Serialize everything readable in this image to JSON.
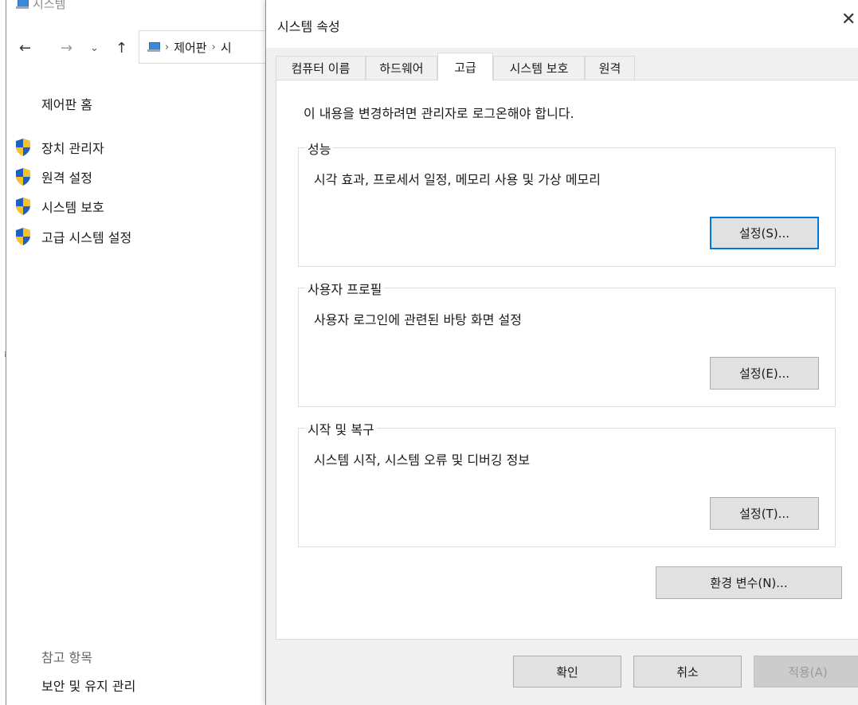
{
  "background": {
    "title": "시스템",
    "nav": {
      "back": "←",
      "forward": "→",
      "recent": "⌄",
      "up": "↑"
    },
    "breadcrumb": [
      "제어판",
      "시"
    ],
    "sidebar": {
      "home": "제어판 홈",
      "links": [
        "장치 관리자",
        "원격 설정",
        "시스템 보호",
        "고급 시스템 설정"
      ]
    },
    "see_also": {
      "heading": "참고 항목",
      "link": "보안 및 유지 관리"
    }
  },
  "dialog": {
    "title": "시스템 속성",
    "close": "✕",
    "tabs": [
      "컴퓨터 이름",
      "하드웨어",
      "고급",
      "시스템 보호",
      "원격"
    ],
    "active_tab": "고급",
    "admin_note": "이 내용을 변경하려면 관리자로 로그온해야 합니다.",
    "groups": {
      "performance": {
        "legend": "성능",
        "desc": "시각 효과, 프로세서 일정, 메모리 사용 및 가상 메모리",
        "button": "설정(S)..."
      },
      "profile": {
        "legend": "사용자 프로필",
        "desc": "사용자 로그인에 관련된 바탕 화면 설정",
        "button": "설정(E)..."
      },
      "startup": {
        "legend": "시작 및 복구",
        "desc": "시스템 시작, 시스템 오류 및 디버깅 정보",
        "button": "설정(T)..."
      }
    },
    "env_button": "환경 변수(N)...",
    "ok": "확인",
    "cancel": "취소",
    "apply": "적용(A)"
  },
  "colors": {
    "accent": "#0078d7",
    "shield_blue": "#1f5fbf",
    "shield_yellow": "#f2c32a"
  },
  "icons": [
    "computer-icon",
    "shield-icon"
  ]
}
